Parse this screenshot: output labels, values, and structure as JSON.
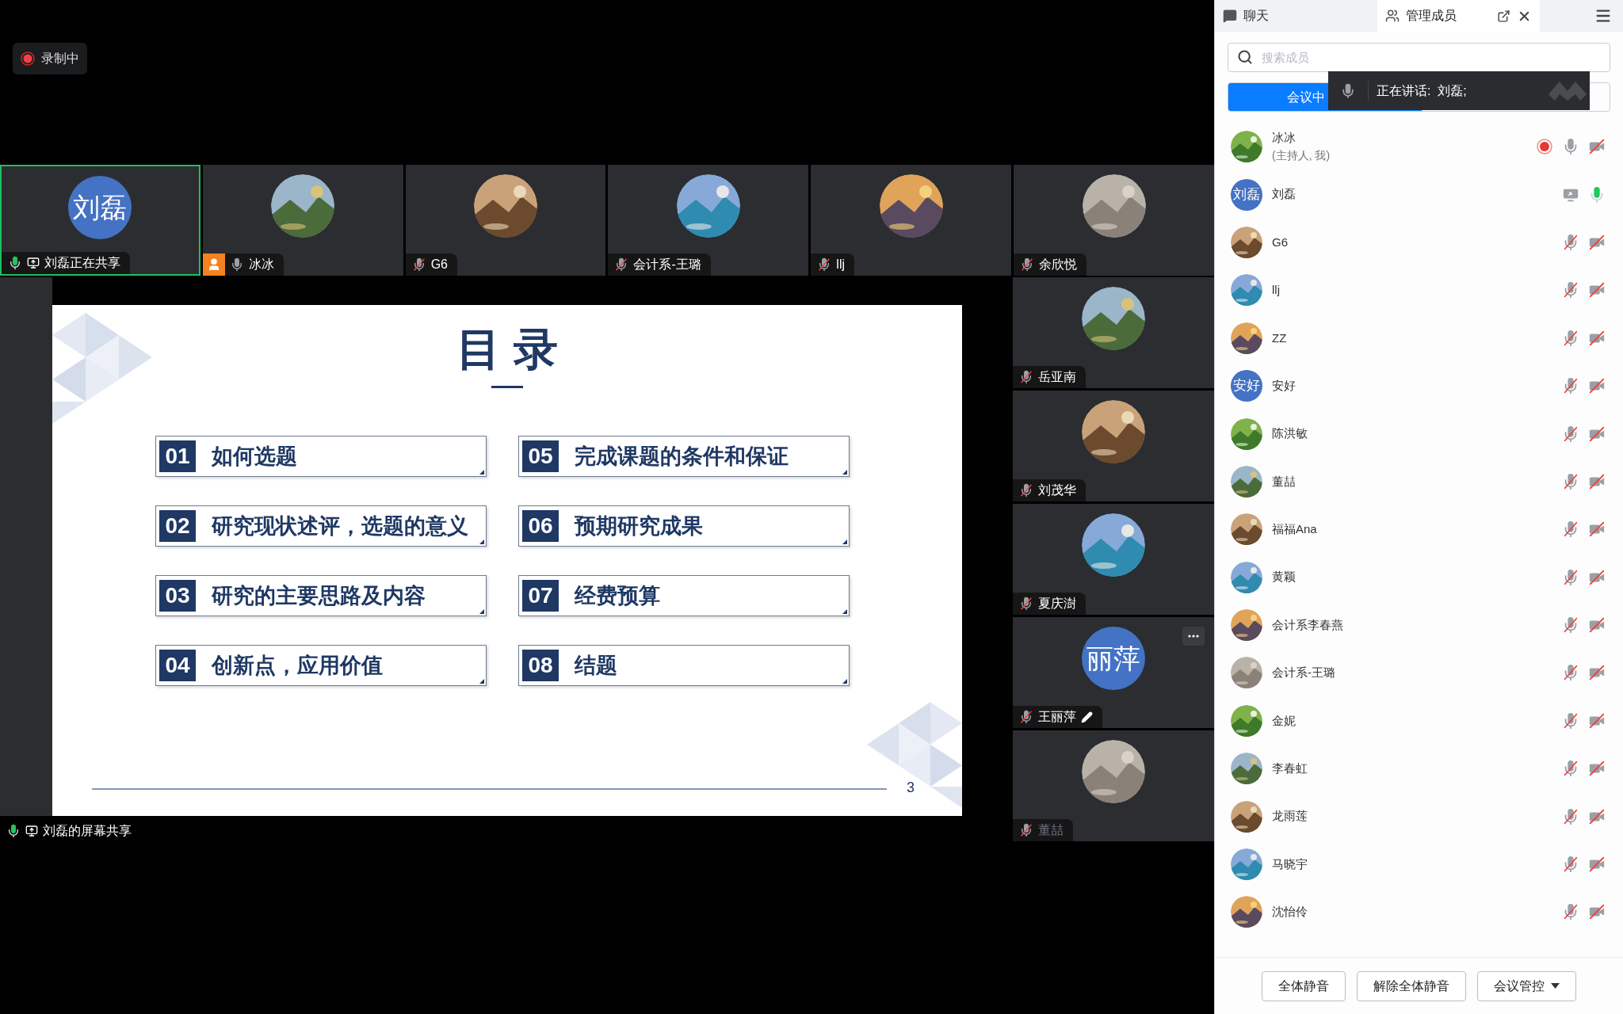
{
  "recording_badge": {
    "label": "录制中",
    "on": true
  },
  "video_strip": [
    {
      "name": "刘磊正在共享",
      "muted": false,
      "speaking": true,
      "sharing": true,
      "host": false,
      "selected": true,
      "avatar": {
        "kind": "text",
        "text": "刘磊"
      }
    },
    {
      "name": "冰冰",
      "muted": false,
      "speaking": false,
      "sharing": false,
      "host": true,
      "selected": false
    },
    {
      "name": "G6",
      "muted": true,
      "speaking": false,
      "sharing": false,
      "host": false,
      "selected": false
    },
    {
      "name": "会计系-王璐",
      "muted": true,
      "speaking": false,
      "sharing": false,
      "host": false,
      "selected": false
    },
    {
      "name": "llj",
      "muted": true,
      "speaking": false,
      "sharing": false,
      "host": false,
      "selected": false
    },
    {
      "name": "余欣悦",
      "muted": true,
      "speaking": false,
      "sharing": false,
      "host": false,
      "selected": false
    }
  ],
  "video_column": [
    {
      "name": "岳亚南",
      "muted": true,
      "editable": false,
      "more": false,
      "dimmed": false
    },
    {
      "name": "刘茂华",
      "muted": true,
      "editable": false,
      "more": false,
      "dimmed": false
    },
    {
      "name": "夏庆澍",
      "muted": true,
      "editable": false,
      "more": false,
      "dimmed": false
    },
    {
      "name": "王丽萍",
      "muted": true,
      "editable": true,
      "more": true,
      "dimmed": false,
      "avatar": {
        "kind": "text",
        "text": "丽萍"
      }
    },
    {
      "name": "董喆",
      "muted": true,
      "editable": false,
      "more": false,
      "dimmed": true
    }
  ],
  "slide": {
    "title": "目 录",
    "page": "3",
    "items": [
      {
        "num": "01",
        "text": "如何选题"
      },
      {
        "num": "02",
        "text": "研究现状述评，选题的意义"
      },
      {
        "num": "03",
        "text": "研究的主要思路及内容"
      },
      {
        "num": "04",
        "text": "创新点，应用价值"
      },
      {
        "num": "05",
        "text": "完成课题的条件和保证"
      },
      {
        "num": "06",
        "text": "预期研究成果"
      },
      {
        "num": "07",
        "text": "经费预算"
      },
      {
        "num": "08",
        "text": "结题"
      }
    ]
  },
  "share_label": {
    "name": "刘磊的屏幕共享",
    "speaking": true,
    "sharing": true
  },
  "panel": {
    "tabs": [
      {
        "label": "聊天",
        "selected": false
      },
      {
        "label": "管理成员",
        "selected": true
      }
    ],
    "search": {
      "placeholder": "搜索成员"
    },
    "segments": [
      {
        "label": "会议中",
        "selected": true
      }
    ],
    "speaking_toast": {
      "text": "正在讲话:  刘磊;"
    },
    "members": [
      {
        "name": "冰冰",
        "note": "(主持人, 我)",
        "recording": true,
        "sharing": false,
        "muted": false,
        "speaking": false,
        "camera_off": true
      },
      {
        "name": "刘磊",
        "avatar": {
          "kind": "text",
          "text": "刘磊"
        },
        "recording": false,
        "sharing": true,
        "muted": false,
        "speaking": true,
        "camera_off": false
      },
      {
        "name": "G6",
        "recording": false,
        "sharing": false,
        "muted": true,
        "speaking": false,
        "camera_off": true
      },
      {
        "name": "llj",
        "recording": false,
        "sharing": false,
        "muted": true,
        "speaking": false,
        "camera_off": true
      },
      {
        "name": "ZZ",
        "recording": false,
        "sharing": false,
        "muted": true,
        "speaking": false,
        "camera_off": true
      },
      {
        "name": "安好",
        "avatar": {
          "kind": "text",
          "text": "安好"
        },
        "recording": false,
        "sharing": false,
        "muted": true,
        "speaking": false,
        "camera_off": true
      },
      {
        "name": "陈洪敏",
        "recording": false,
        "sharing": false,
        "muted": true,
        "speaking": false,
        "camera_off": true
      },
      {
        "name": "董喆",
        "recording": false,
        "sharing": false,
        "muted": true,
        "speaking": false,
        "camera_off": true
      },
      {
        "name": "福福Ana",
        "recording": false,
        "sharing": false,
        "muted": true,
        "speaking": false,
        "camera_off": true
      },
      {
        "name": "黄颖",
        "recording": false,
        "sharing": false,
        "muted": true,
        "speaking": false,
        "camera_off": true
      },
      {
        "name": "会计系李春燕",
        "recording": false,
        "sharing": false,
        "muted": true,
        "speaking": false,
        "camera_off": true
      },
      {
        "name": "会计系-王璐",
        "recording": false,
        "sharing": false,
        "muted": true,
        "speaking": false,
        "camera_off": true
      },
      {
        "name": "金妮",
        "recording": false,
        "sharing": false,
        "muted": true,
        "speaking": false,
        "camera_off": true
      },
      {
        "name": "李春虹",
        "recording": false,
        "sharing": false,
        "muted": true,
        "speaking": false,
        "camera_off": true
      },
      {
        "name": "龙雨莲",
        "recording": false,
        "sharing": false,
        "muted": true,
        "speaking": false,
        "camera_off": true
      },
      {
        "name": "马晓宇",
        "recording": false,
        "sharing": false,
        "muted": true,
        "speaking": false,
        "camera_off": true
      },
      {
        "name": "沈怡伶",
        "recording": false,
        "sharing": false,
        "muted": true,
        "speaking": false,
        "camera_off": true
      }
    ],
    "footer_buttons": [
      {
        "label": "全体静音",
        "dropdown": false
      },
      {
        "label": "解除全体静音",
        "dropdown": false
      },
      {
        "label": "会议管控",
        "dropdown": true
      }
    ]
  }
}
